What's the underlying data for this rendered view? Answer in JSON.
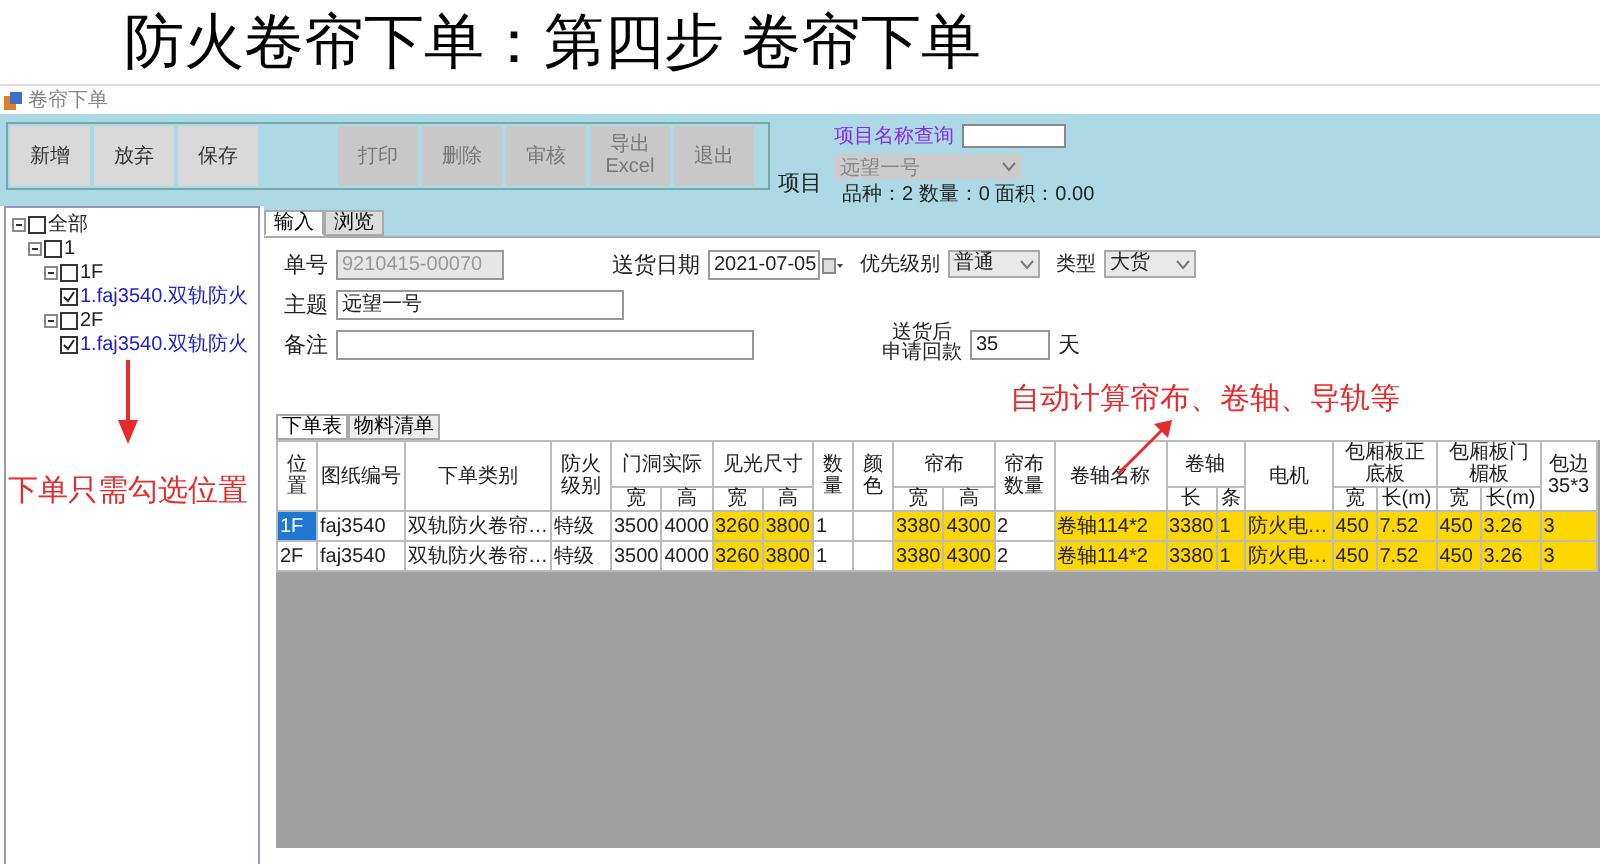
{
  "banner": {
    "title": "防火卷帘下单：第四步 卷帘下单"
  },
  "window": {
    "title": "卷帘下单"
  },
  "toolbar": {
    "edit_buttons": [
      {
        "label": "新增",
        "disabled": false
      },
      {
        "label": "放弃",
        "disabled": false
      },
      {
        "label": "保存",
        "disabled": false
      }
    ],
    "action_buttons": [
      {
        "label": "打印",
        "disabled": true
      },
      {
        "label": "删除",
        "disabled": true
      },
      {
        "label": "审核",
        "disabled": true
      },
      {
        "label": "导出\nExcel",
        "disabled": true
      },
      {
        "label": "退出",
        "disabled": true
      }
    ]
  },
  "project": {
    "search_label": "项目名称查询",
    "label": "项目",
    "value": "远望一号",
    "summary": "品种：2 数量：0 面积：0.00"
  },
  "tree": [
    {
      "label": "全部",
      "checked": false,
      "expanded": true,
      "children": [
        {
          "label": "1",
          "checked": false,
          "expanded": true,
          "children": [
            {
              "label": "1F",
              "checked": false,
              "expanded": true,
              "children": [
                {
                  "label": "1.faj3540.双轨防火",
                  "checked": true
                }
              ]
            },
            {
              "label": "2F",
              "checked": false,
              "expanded": true,
              "children": [
                {
                  "label": "1.faj3540.双轨防火",
                  "checked": true
                }
              ]
            }
          ]
        }
      ]
    }
  ],
  "tabs": [
    {
      "label": "输入",
      "selected": true
    },
    {
      "label": "浏览",
      "selected": false
    }
  ],
  "form": {
    "order_no_label": "单号",
    "order_no": "9210415-00070",
    "date_label": "送货日期",
    "date": "2021-07-05",
    "priority_label": "优先级别",
    "priority": "普通",
    "type_label": "类型",
    "type": "大货",
    "subject_label": "主题",
    "subject": "远望一号",
    "note_label": "备注",
    "payment_label_lines": [
      "送货后",
      "申请回款"
    ],
    "payment_days": "35",
    "payment_unit": "天"
  },
  "subtabs": [
    {
      "label": "下单表",
      "selected": true
    },
    {
      "label": "物料清单",
      "selected": false
    }
  ],
  "table": {
    "header_groups": [
      {
        "label": "位置",
        "kind": "single",
        "highlight": false
      },
      {
        "label": "图纸编号",
        "kind": "single",
        "highlight": false
      },
      {
        "label": "下单类别",
        "kind": "single",
        "highlight": false
      },
      {
        "label": "防火级别",
        "kind": "single",
        "highlight": false
      },
      {
        "label": "门洞实际",
        "kind": "group",
        "sub": [
          "宽",
          "高"
        ],
        "highlight": false
      },
      {
        "label": "见光尺寸",
        "kind": "group",
        "sub": [
          "宽",
          "高"
        ],
        "highlight": true
      },
      {
        "label": "数量",
        "kind": "single",
        "highlight": false
      },
      {
        "label": "颜色",
        "kind": "single",
        "highlight": false
      },
      {
        "label": "帘布",
        "kind": "group",
        "sub": [
          "宽",
          "高"
        ],
        "highlight": true
      },
      {
        "label": "帘布数量",
        "kind": "single",
        "highlight": false
      },
      {
        "label": "卷轴名称",
        "kind": "single",
        "highlight": true
      },
      {
        "label": "卷轴",
        "kind": "group",
        "sub": [
          "长",
          "条"
        ],
        "highlight": true
      },
      {
        "label": "电机",
        "kind": "single",
        "highlight": true
      },
      {
        "label": "包厢板正底板",
        "kind": "group",
        "sub": [
          "宽",
          "长(m)"
        ],
        "highlight": true
      },
      {
        "label": "包厢板门楣板",
        "kind": "group",
        "sub": [
          "宽",
          "长(m)"
        ],
        "highlight": true
      },
      {
        "label": "包边\n35*3",
        "kind": "single",
        "highlight": true
      }
    ],
    "rows": [
      {
        "selected": true,
        "cells": [
          "1F",
          "faj3540",
          "双轨防火卷帘…",
          "特级",
          "3500",
          "4000",
          "3260",
          "3800",
          "1",
          "",
          "3380",
          "4300",
          "2",
          "卷轴114*2",
          "3380",
          "1",
          "防火电…",
          "450",
          "7.52",
          "450",
          "3.26",
          "3"
        ]
      },
      {
        "selected": false,
        "cells": [
          "2F",
          "faj3540",
          "双轨防火卷帘…",
          "特级",
          "3500",
          "4000",
          "3260",
          "3800",
          "1",
          "",
          "3380",
          "4300",
          "2",
          "卷轴114*2",
          "3380",
          "1",
          "防火电…",
          "450",
          "7.52",
          "450",
          "3.26",
          "3"
        ]
      }
    ]
  },
  "annotations": [
    {
      "text": "下单只需勾选位置",
      "kind": "down"
    },
    {
      "text": "自动计算帘布、卷轴、导轨等",
      "kind": "up"
    }
  ]
}
